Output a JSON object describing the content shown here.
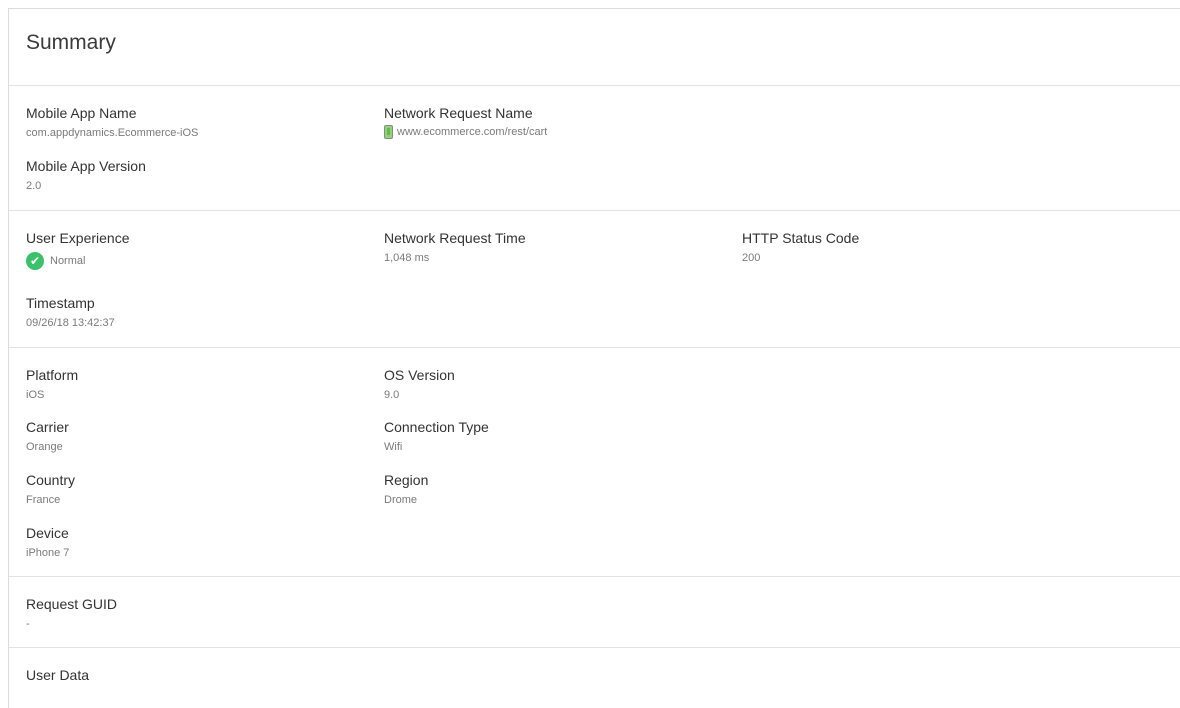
{
  "header": {
    "title": "Summary"
  },
  "section1": {
    "app_name": {
      "label": "Mobile App Name",
      "value": "com.appdynamics.Ecommerce-iOS"
    },
    "request_name": {
      "label": "Network Request Name",
      "value": "www.ecommerce.com/rest/cart",
      "icon": "mobile-phone-icon"
    },
    "app_version": {
      "label": "Mobile App Version",
      "value": "2.0"
    }
  },
  "section2": {
    "user_experience": {
      "label": "User Experience",
      "value": "Normal",
      "icon": "check-circle-icon",
      "color": "#3cc06b"
    },
    "request_time": {
      "label": "Network Request Time",
      "value": "1,048 ms"
    },
    "status_code": {
      "label": "HTTP Status Code",
      "value": "200"
    },
    "timestamp": {
      "label": "Timestamp",
      "value": "09/26/18 13:42:37"
    }
  },
  "section3": {
    "platform": {
      "label": "Platform",
      "value": "iOS"
    },
    "os_version": {
      "label": "OS Version",
      "value": "9.0"
    },
    "carrier": {
      "label": "Carrier",
      "value": "Orange"
    },
    "connection_type": {
      "label": "Connection Type",
      "value": "Wifi"
    },
    "country": {
      "label": "Country",
      "value": "France"
    },
    "region": {
      "label": "Region",
      "value": "Drome"
    },
    "device": {
      "label": "Device",
      "value": "iPhone 7"
    }
  },
  "section4": {
    "request_guid": {
      "label": "Request GUID",
      "value": "-"
    }
  },
  "section5": {
    "user_data": {
      "label": "User Data"
    }
  }
}
